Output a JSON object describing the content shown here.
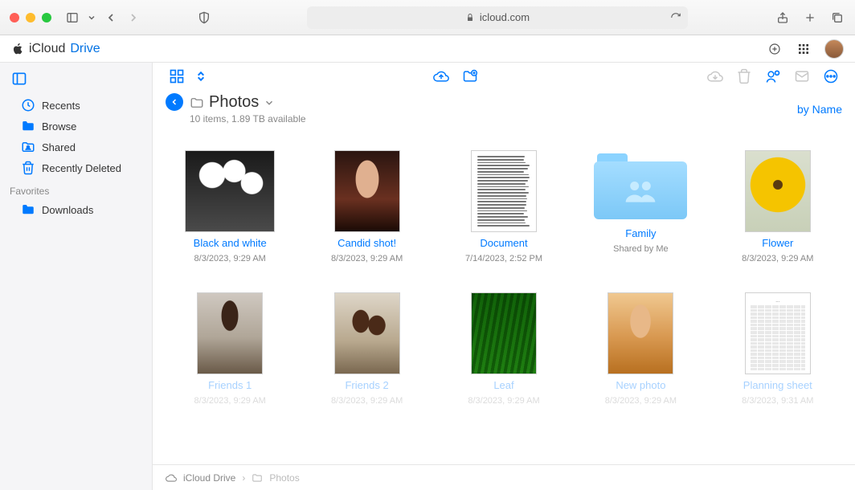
{
  "browser": {
    "url": "icloud.com"
  },
  "brand": {
    "name": "iCloud",
    "product": "Drive"
  },
  "sidebar": {
    "items": [
      {
        "label": "Recents"
      },
      {
        "label": "Browse"
      },
      {
        "label": "Shared"
      },
      {
        "label": "Recently Deleted"
      }
    ],
    "favorites_label": "Favorites",
    "favorites": [
      {
        "label": "Downloads"
      }
    ]
  },
  "location": {
    "title": "Photos",
    "subtitle": "10 items, 1.89 TB available",
    "sort": "by Name"
  },
  "items": [
    {
      "name": "Black and white",
      "meta": "8/3/2023, 9:29 AM",
      "thumb": "bw",
      "shape": "wide"
    },
    {
      "name": "Candid shot!",
      "meta": "8/3/2023, 9:29 AM",
      "thumb": "candid",
      "shape": "portrait"
    },
    {
      "name": "Document",
      "meta": "7/14/2023, 2:52 PM",
      "thumb": "doc",
      "shape": "doc"
    },
    {
      "name": "Family",
      "meta": "Shared by Me",
      "thumb": "folder",
      "shape": "folder"
    },
    {
      "name": "Flower",
      "meta": "8/3/2023, 9:29 AM",
      "thumb": "flower",
      "shape": "portrait"
    },
    {
      "name": "Friends 1",
      "meta": "8/3/2023, 9:29 AM",
      "thumb": "friends1",
      "shape": "portrait",
      "faded": true
    },
    {
      "name": "Friends 2",
      "meta": "8/3/2023, 9:29 AM",
      "thumb": "friends2",
      "shape": "portrait",
      "faded": true
    },
    {
      "name": "Leaf",
      "meta": "8/3/2023, 9:29 AM",
      "thumb": "leaf",
      "shape": "portrait",
      "faded": true
    },
    {
      "name": "New photo",
      "meta": "8/3/2023, 9:29 AM",
      "thumb": "new",
      "shape": "portrait",
      "faded": true
    },
    {
      "name": "Planning sheet",
      "meta": "8/3/2023, 9:31 AM",
      "thumb": "sheet",
      "shape": "doc",
      "faded": true
    }
  ],
  "breadcrumb": {
    "root": "iCloud Drive",
    "current": "Photos"
  }
}
